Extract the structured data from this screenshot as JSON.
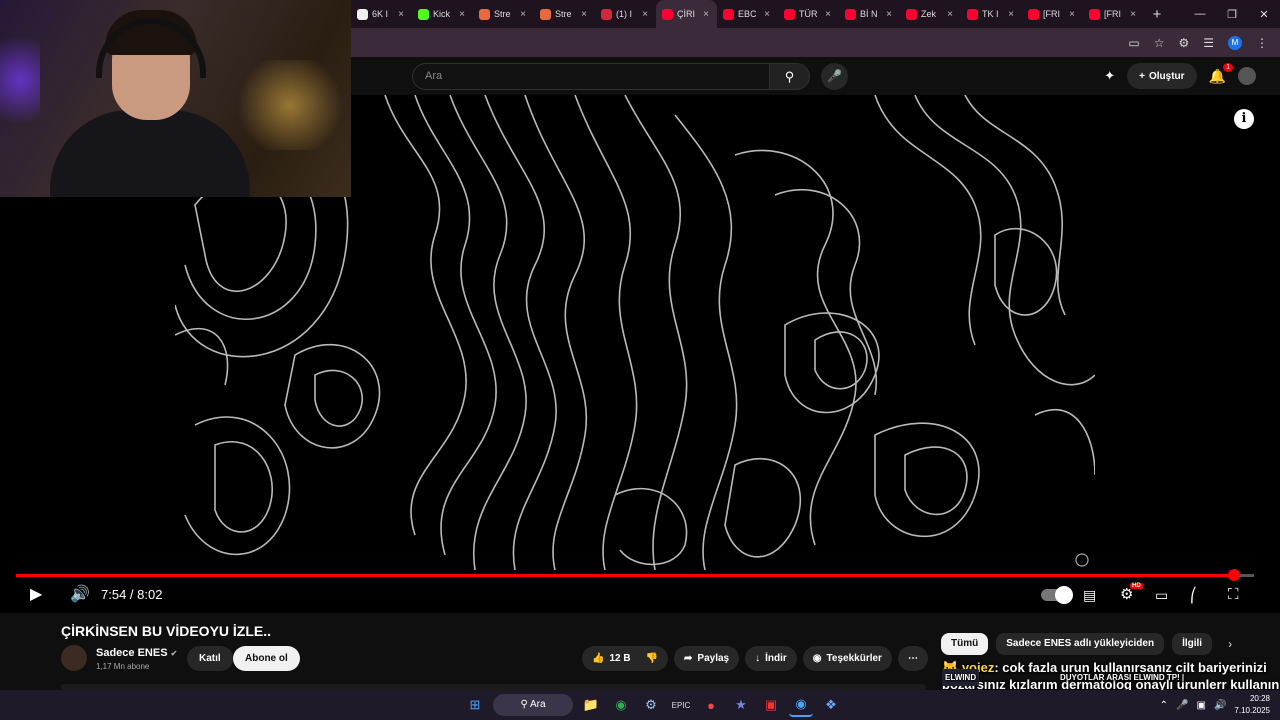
{
  "browser": {
    "tabs": [
      {
        "label": "6K I",
        "color": "#f0f0f0"
      },
      {
        "label": "Kick",
        "color": "#53fc18"
      },
      {
        "label": "Stre",
        "color": "#e66a3c"
      },
      {
        "label": "Stre",
        "color": "#e66a3c"
      },
      {
        "label": "(1) I",
        "color": "#d0283c"
      },
      {
        "label": "ÇİRI",
        "color": "#ff0033"
      },
      {
        "label": "EBC",
        "color": "#ff0033"
      },
      {
        "label": "TÜR",
        "color": "#ff0033"
      },
      {
        "label": "Bİ N",
        "color": "#ff0033"
      },
      {
        "label": "Zek",
        "color": "#ff0033"
      },
      {
        "label": "TK I",
        "color": "#ff0033"
      },
      {
        "label": "[FRI",
        "color": "#ff0033"
      },
      {
        "label": "[FRI",
        "color": "#ff0033"
      }
    ],
    "active_tab_index": 5,
    "close_glyph": "×",
    "new_tab_glyph": "+",
    "profile_initial": "M"
  },
  "masthead": {
    "search_placeholder": "Ara",
    "create_label": "Oluştur",
    "notification_count": "1"
  },
  "player": {
    "time_display": "7:54 / 8:02",
    "progress_fraction": 0.984,
    "hd_badge": "HD",
    "info_glyph": "i"
  },
  "video": {
    "title": "ÇİRKİNSEN BU VİDEOYU İZLE..",
    "channel_name": "Sadece ENES",
    "verified_glyph": "✔",
    "subscribers": "1,17 Mn abone",
    "join_label": "Katıl",
    "subscribe_label": "Abone ol",
    "like_count": "12 B",
    "share_label": "Paylaş",
    "download_label": "İndir",
    "thanks_label": "Teşekkürler",
    "more_glyph": "⋯"
  },
  "recommendations": {
    "chips": [
      "Tümü",
      "Sadece ENES adlı yükleyiciden",
      "İlgili"
    ],
    "next_glyph": "›"
  },
  "stream_chat": {
    "username": "yoiez",
    "message": ": cok fazla urun kullanırsanız cilt bariyerinizi bozarsınız kızlarım dermatolog onaylı urunlerr kullanın sadece",
    "tag": "ELWIND",
    "tag_banner": "DUYOTLAR ARASI ELWIND TP! |"
  },
  "taskbar": {
    "search_label": "Ara",
    "time": "20:28",
    "date": "7.10.2025"
  },
  "colors": {
    "youtube_red": "#ff0000",
    "background": "#0f0f0f",
    "pill": "#272727"
  }
}
